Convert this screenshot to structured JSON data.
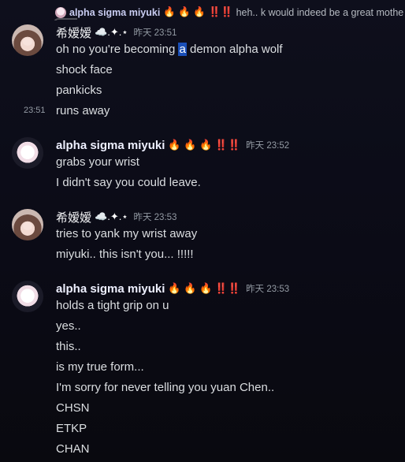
{
  "reply": {
    "name": "alpha sigma miyuki",
    "decor": "🔥 🔥 🔥 ‼️‼️",
    "text": "heh.. k would indeed be a great mothe"
  },
  "groups": [
    {
      "author": "希嫒嫒",
      "author_decor": "☁️.✦.⋆",
      "timestamp": "昨天 23:51",
      "lines": [
        {
          "before": "oh no you're becoming ",
          "highlight": "a",
          "after": " demon alpha wolf"
        },
        {
          "text": "shock face"
        },
        {
          "text": "pankicks"
        },
        {
          "text": "runs away",
          "side_time": "23:51"
        }
      ]
    },
    {
      "author": "alpha sigma miyuki",
      "author_decor": "🔥 🔥 🔥 ‼️‼️",
      "timestamp": "昨天 23:52",
      "lines": [
        {
          "text": "grabs your wrist"
        },
        {
          "text": "I didn't say you could leave."
        }
      ]
    },
    {
      "author": "希嫒嫒",
      "author_decor": "☁️.✦.⋆",
      "timestamp": "昨天 23:53",
      "lines": [
        {
          "text": "tries to yank my wrist away"
        },
        {
          "text": "miyuki.. this isn't you... !!!!!"
        }
      ]
    },
    {
      "author": "alpha sigma miyuki",
      "author_decor": "🔥 🔥 🔥 ‼️‼️",
      "timestamp": "昨天 23:53",
      "lines": [
        {
          "text": "holds a tight grip on u"
        },
        {
          "text": "yes.."
        },
        {
          "text": "this.."
        },
        {
          "text": "is my true form..."
        },
        {
          "text": "I'm sorry for never telling you yuan Chen.."
        },
        {
          "text": "CHSN"
        },
        {
          "text": "ETKP"
        },
        {
          "text": "CHAN"
        }
      ]
    }
  ]
}
